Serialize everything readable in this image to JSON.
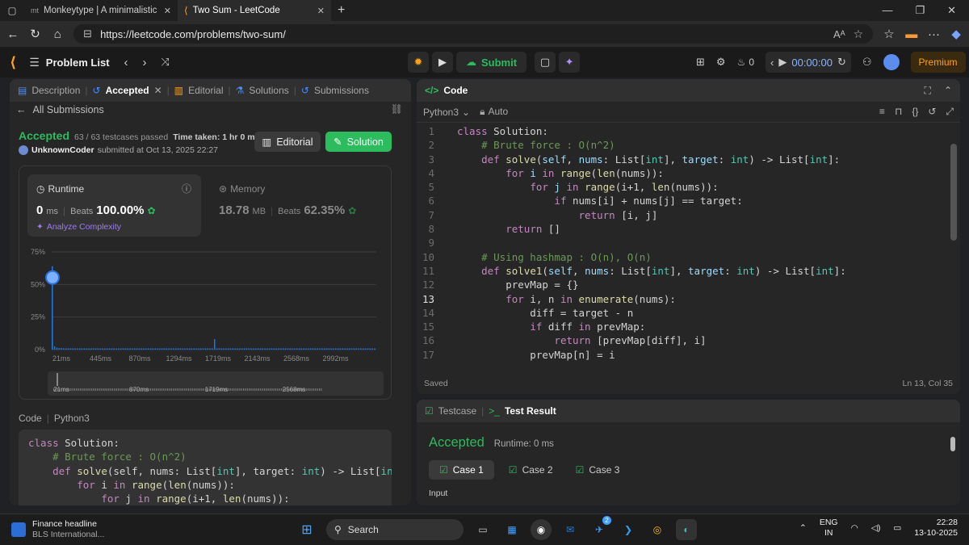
{
  "browser": {
    "tabs": [
      {
        "favicon": "mt",
        "title": "Monkeytype | A minimalistic, cust"
      },
      {
        "favicon": "lc",
        "title": "Two Sum - LeetCode"
      }
    ],
    "url": "https://leetcode.com/problems/two-sum/",
    "read_aloud": "Aᴬ"
  },
  "header": {
    "problem_list": "Problem List",
    "submit": "Submit",
    "streak": "0",
    "timer": "00:00:00",
    "premium": "Premium"
  },
  "left": {
    "tabs": {
      "description": "Description",
      "accepted": "Accepted",
      "editorial": "Editorial",
      "solutions": "Solutions",
      "submissions": "Submissions"
    },
    "all_submissions": "All Submissions",
    "status": "Accepted",
    "testcases": "63 / 63 testcases passed",
    "time_taken": "Time taken: 1 hr 0 m 22 s",
    "user": "UnknownCoder",
    "submitted_at": "submitted at Oct 13, 2025 22:27",
    "editorial_btn": "Editorial",
    "solution_btn": "Solution",
    "runtime": {
      "label": "Runtime",
      "value": "0",
      "unit": "ms",
      "beats_label": "Beats",
      "beats": "100.00%"
    },
    "memory": {
      "label": "Memory",
      "value": "18.78",
      "unit": "MB",
      "beats_label": "Beats",
      "beats": "62.35%"
    },
    "analyze": "Analyze Complexity",
    "code_label": "Code",
    "code_lang": "Python3",
    "code_lines": [
      [
        {
          "t": "class ",
          "c": "kw"
        },
        {
          "t": "Solution:",
          "c": "pl"
        }
      ],
      [
        {
          "t": "    # Brute force : O(n^2)",
          "c": "cm"
        }
      ],
      [
        {
          "t": "    ",
          "c": "pl"
        },
        {
          "t": "def ",
          "c": "kw"
        },
        {
          "t": "solve",
          "c": "fn"
        },
        {
          "t": "(self, nums: List[",
          "c": "pl"
        },
        {
          "t": "int",
          "c": "bi"
        },
        {
          "t": "], target: ",
          "c": "pl"
        },
        {
          "t": "int",
          "c": "bi"
        },
        {
          "t": ") -> List[",
          "c": "pl"
        },
        {
          "t": "int",
          "c": "bi"
        },
        {
          "t": "]:",
          "c": "pl"
        }
      ],
      [
        {
          "t": "        ",
          "c": "pl"
        },
        {
          "t": "for ",
          "c": "kw"
        },
        {
          "t": "i ",
          "c": "pl"
        },
        {
          "t": "in ",
          "c": "kw"
        },
        {
          "t": "range",
          "c": "fn"
        },
        {
          "t": "(",
          "c": "pl"
        },
        {
          "t": "len",
          "c": "fn"
        },
        {
          "t": "(nums)):",
          "c": "pl"
        }
      ],
      [
        {
          "t": "            ",
          "c": "pl"
        },
        {
          "t": "for ",
          "c": "kw"
        },
        {
          "t": "j ",
          "c": "pl"
        },
        {
          "t": "in ",
          "c": "kw"
        },
        {
          "t": "range",
          "c": "fn"
        },
        {
          "t": "(i+1, ",
          "c": "pl"
        },
        {
          "t": "len",
          "c": "fn"
        },
        {
          "t": "(nums)):",
          "c": "pl"
        }
      ],
      [
        {
          "t": "                ",
          "c": "pl"
        },
        {
          "t": "if ",
          "c": "kw"
        },
        {
          "t": "nums[i] + nums[j] == target:",
          "c": "pl"
        }
      ]
    ]
  },
  "chart_data": {
    "type": "bar",
    "title": "",
    "ylim": [
      0,
      75
    ],
    "yticks": [
      "75%",
      "50%",
      "25%",
      "0%"
    ],
    "xticks": [
      "21ms",
      "445ms",
      "870ms",
      "1294ms",
      "1719ms",
      "2143ms",
      "2568ms",
      "2992ms"
    ],
    "series": [
      {
        "values": [
          64,
          2.5,
          1.5,
          1.2,
          1.2,
          1,
          1,
          1,
          1,
          1,
          1,
          1,
          1,
          1,
          1,
          1,
          1,
          1,
          1,
          1,
          1,
          1,
          1,
          1,
          1,
          1,
          1,
          1,
          1,
          1,
          1,
          1,
          1,
          1,
          1,
          1,
          1,
          1,
          1,
          1,
          1,
          1,
          1,
          1,
          1,
          1,
          1,
          1,
          1,
          1,
          1,
          1,
          1,
          1,
          1,
          1,
          1,
          1,
          1,
          1,
          1,
          1,
          1,
          1,
          1,
          1,
          1,
          1,
          1,
          1,
          1,
          1,
          1,
          1,
          1,
          1,
          1,
          1,
          1,
          1,
          1,
          1,
          1,
          1,
          1,
          1,
          1,
          1,
          1,
          1,
          1,
          1,
          1,
          1,
          1,
          1,
          1,
          1,
          1,
          1,
          1,
          1,
          1,
          1,
          1,
          1,
          1,
          1,
          1,
          1,
          1,
          1,
          1,
          1,
          1,
          1,
          1,
          1,
          1,
          1,
          1,
          1,
          1,
          1,
          1,
          1,
          1,
          1,
          1,
          1,
          1,
          1,
          1,
          1,
          1,
          1,
          1,
          1,
          1,
          1,
          1,
          1
        ]
      }
    ],
    "spike_index": 71,
    "spike_value": 8,
    "highlight_index": 0,
    "minimap_labels": [
      "21ms",
      "870ms",
      "1719ms",
      "2568ms"
    ]
  },
  "editor": {
    "title": "Code",
    "language": "Python3",
    "auto": "Auto",
    "status": "Saved",
    "cursor": "Ln 13, Col 35",
    "current_line": 13,
    "lines": [
      [
        {
          "t": "class ",
          "c": "kw"
        },
        {
          "t": "Solution:",
          "c": "pl"
        }
      ],
      [
        {
          "t": "    # Brute force : O(n^2)",
          "c": "cm"
        }
      ],
      [
        {
          "t": "    ",
          "c": "pl"
        },
        {
          "t": "def ",
          "c": "kw"
        },
        {
          "t": "solve",
          "c": "fn"
        },
        {
          "t": "(",
          "c": "pl"
        },
        {
          "t": "self",
          "c": "nm"
        },
        {
          "t": ", ",
          "c": "pl"
        },
        {
          "t": "nums",
          "c": "nm"
        },
        {
          "t": ": List[",
          "c": "pl"
        },
        {
          "t": "int",
          "c": "bi"
        },
        {
          "t": "], ",
          "c": "pl"
        },
        {
          "t": "target",
          "c": "nm"
        },
        {
          "t": ": ",
          "c": "pl"
        },
        {
          "t": "int",
          "c": "bi"
        },
        {
          "t": ") -> List[",
          "c": "pl"
        },
        {
          "t": "int",
          "c": "bi"
        },
        {
          "t": "]:",
          "c": "pl"
        }
      ],
      [
        {
          "t": "        ",
          "c": "pl"
        },
        {
          "t": "for ",
          "c": "kw"
        },
        {
          "t": "i ",
          "c": "nm"
        },
        {
          "t": "in ",
          "c": "kw"
        },
        {
          "t": "range",
          "c": "fn"
        },
        {
          "t": "(",
          "c": "pl"
        },
        {
          "t": "len",
          "c": "fn"
        },
        {
          "t": "(nums)):",
          "c": "pl"
        }
      ],
      [
        {
          "t": "            ",
          "c": "pl"
        },
        {
          "t": "for ",
          "c": "kw"
        },
        {
          "t": "j ",
          "c": "nm"
        },
        {
          "t": "in ",
          "c": "kw"
        },
        {
          "t": "range",
          "c": "fn"
        },
        {
          "t": "(i+1, ",
          "c": "pl"
        },
        {
          "t": "len",
          "c": "fn"
        },
        {
          "t": "(nums)):",
          "c": "pl"
        }
      ],
      [
        {
          "t": "                ",
          "c": "pl"
        },
        {
          "t": "if ",
          "c": "kw"
        },
        {
          "t": "nums[i] + nums[j] == target:",
          "c": "pl"
        }
      ],
      [
        {
          "t": "                    ",
          "c": "pl"
        },
        {
          "t": "return ",
          "c": "kw"
        },
        {
          "t": "[i, j]",
          "c": "pl"
        }
      ],
      [
        {
          "t": "        ",
          "c": "pl"
        },
        {
          "t": "return ",
          "c": "kw"
        },
        {
          "t": "[]",
          "c": "pl"
        }
      ],
      [
        {
          "t": "",
          "c": "pl"
        }
      ],
      [
        {
          "t": "    # Using hashmap : O(n), O(n)",
          "c": "cm"
        }
      ],
      [
        {
          "t": "    ",
          "c": "pl"
        },
        {
          "t": "def ",
          "c": "kw"
        },
        {
          "t": "solve1",
          "c": "fn"
        },
        {
          "t": "(",
          "c": "pl"
        },
        {
          "t": "self",
          "c": "nm"
        },
        {
          "t": ", ",
          "c": "pl"
        },
        {
          "t": "nums",
          "c": "nm"
        },
        {
          "t": ": List[",
          "c": "pl"
        },
        {
          "t": "int",
          "c": "bi"
        },
        {
          "t": "], ",
          "c": "pl"
        },
        {
          "t": "target",
          "c": "nm"
        },
        {
          "t": ": ",
          "c": "pl"
        },
        {
          "t": "int",
          "c": "bi"
        },
        {
          "t": ") -> List[",
          "c": "pl"
        },
        {
          "t": "int",
          "c": "bi"
        },
        {
          "t": "]:",
          "c": "pl"
        }
      ],
      [
        {
          "t": "        prevMap = {}",
          "c": "pl"
        }
      ],
      [
        {
          "t": "        ",
          "c": "pl"
        },
        {
          "t": "for ",
          "c": "kw"
        },
        {
          "t": "i, n ",
          "c": "pl"
        },
        {
          "t": "in ",
          "c": "kw"
        },
        {
          "t": "enumerate",
          "c": "fn"
        },
        {
          "t": "(nums):",
          "c": "pl"
        }
      ],
      [
        {
          "t": "            diff = target - n",
          "c": "pl"
        }
      ],
      [
        {
          "t": "            ",
          "c": "pl"
        },
        {
          "t": "if ",
          "c": "kw"
        },
        {
          "t": "diff ",
          "c": "pl"
        },
        {
          "t": "in ",
          "c": "kw"
        },
        {
          "t": "prevMap:",
          "c": "pl"
        }
      ],
      [
        {
          "t": "                ",
          "c": "pl"
        },
        {
          "t": "return ",
          "c": "kw"
        },
        {
          "t": "[prevMap[diff], i]",
          "c": "pl"
        }
      ],
      [
        {
          "t": "            prevMap[n] = i",
          "c": "pl"
        }
      ]
    ]
  },
  "result": {
    "tab_testcase": "Testcase",
    "tab_result": "Test Result",
    "status": "Accepted",
    "runtime": "Runtime: 0 ms",
    "cases": [
      "Case 1",
      "Case 2",
      "Case 3"
    ],
    "input_label": "Input"
  },
  "taskbar": {
    "news_title": "Finance headline",
    "news_sub": "BLS International...",
    "search": "Search",
    "lang1": "ENG",
    "lang2": "IN",
    "time": "22:28",
    "date": "13-10-2025",
    "badge": "2"
  },
  "colors": {
    "accent_green": "#2cbb5d",
    "premium": "#ffa116",
    "bar_blue": "#1a73e8"
  }
}
